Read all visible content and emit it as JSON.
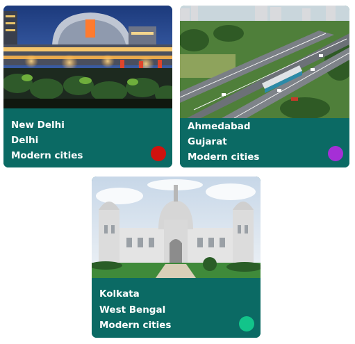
{
  "theme": {
    "panel_color": "#0b6a64"
  },
  "cards": [
    {
      "city": "New Delhi",
      "state": "Delhi",
      "category": "Modern cities",
      "image_icon": "city-mall-night-photo",
      "dot_color": "#d0120e"
    },
    {
      "city": "Ahmedabad",
      "state": "Gujarat",
      "category": "Modern cities",
      "image_icon": "city-highway-aerial-photo",
      "dot_color": "#a52fd6"
    },
    {
      "city": "Kolkata",
      "state": "West Bengal",
      "category": "Modern cities",
      "image_icon": "victoria-memorial-photo",
      "dot_color": "#12c48a"
    }
  ]
}
